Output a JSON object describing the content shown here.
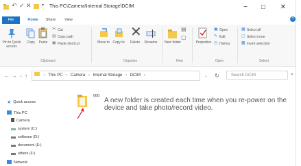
{
  "window": {
    "title": "This PC\\Camera\\Internal Storage\\DCIM",
    "controls": {
      "minimize": "−",
      "maximize": "□",
      "close": "✕"
    }
  },
  "ribbon_tabs": [
    "File",
    "Home",
    "Share",
    "View"
  ],
  "ribbon": {
    "clipboard": {
      "pin": "Pin to Quick access",
      "copy": "Copy",
      "paste": "Paste",
      "cut": "Cut",
      "copy_path": "Copy path",
      "paste_shortcut": "Paste shortcut",
      "label": "Clipboard"
    },
    "organize": {
      "move_to": "Move to",
      "copy_to": "Copy to",
      "delete": "Delete",
      "rename": "Rename",
      "label": "Organize"
    },
    "new": {
      "new_folder": "New folder",
      "label": "New"
    },
    "open": {
      "properties": "Properties",
      "open": "Open",
      "edit": "Edit",
      "history": "History",
      "label": "Open"
    },
    "select": {
      "select_all": "Select all",
      "select_none": "Select none",
      "invert": "Invert selection",
      "label": "Select"
    }
  },
  "address": {
    "breadcrumbs": [
      "This PC",
      "Camera",
      "Internal Storage",
      "DCIM"
    ],
    "search_placeholder": "Search DCIM"
  },
  "nav_pane": {
    "items": [
      {
        "label": "Quick access",
        "icon": "star-icon"
      },
      {
        "label": "This PC",
        "icon": "computer-icon"
      },
      {
        "label": "Camera",
        "icon": "camera-icon"
      },
      {
        "label": "system (C:)",
        "icon": "drive-icon"
      },
      {
        "label": "software (D:)",
        "icon": "drive-icon"
      },
      {
        "label": "document (E:)",
        "icon": "drive-icon"
      },
      {
        "label": "others (F:)",
        "icon": "drive-icon"
      },
      {
        "label": "Network",
        "icon": "network-icon"
      }
    ]
  },
  "content": {
    "folder_name": "000",
    "note": "A new folder is created each time when you re-power on the device and take photo/record video."
  },
  "colors": {
    "accent": "#1a73c6",
    "folder": "#f2c94c",
    "arrow": "#d9262b",
    "selection": "#cce8ff"
  }
}
